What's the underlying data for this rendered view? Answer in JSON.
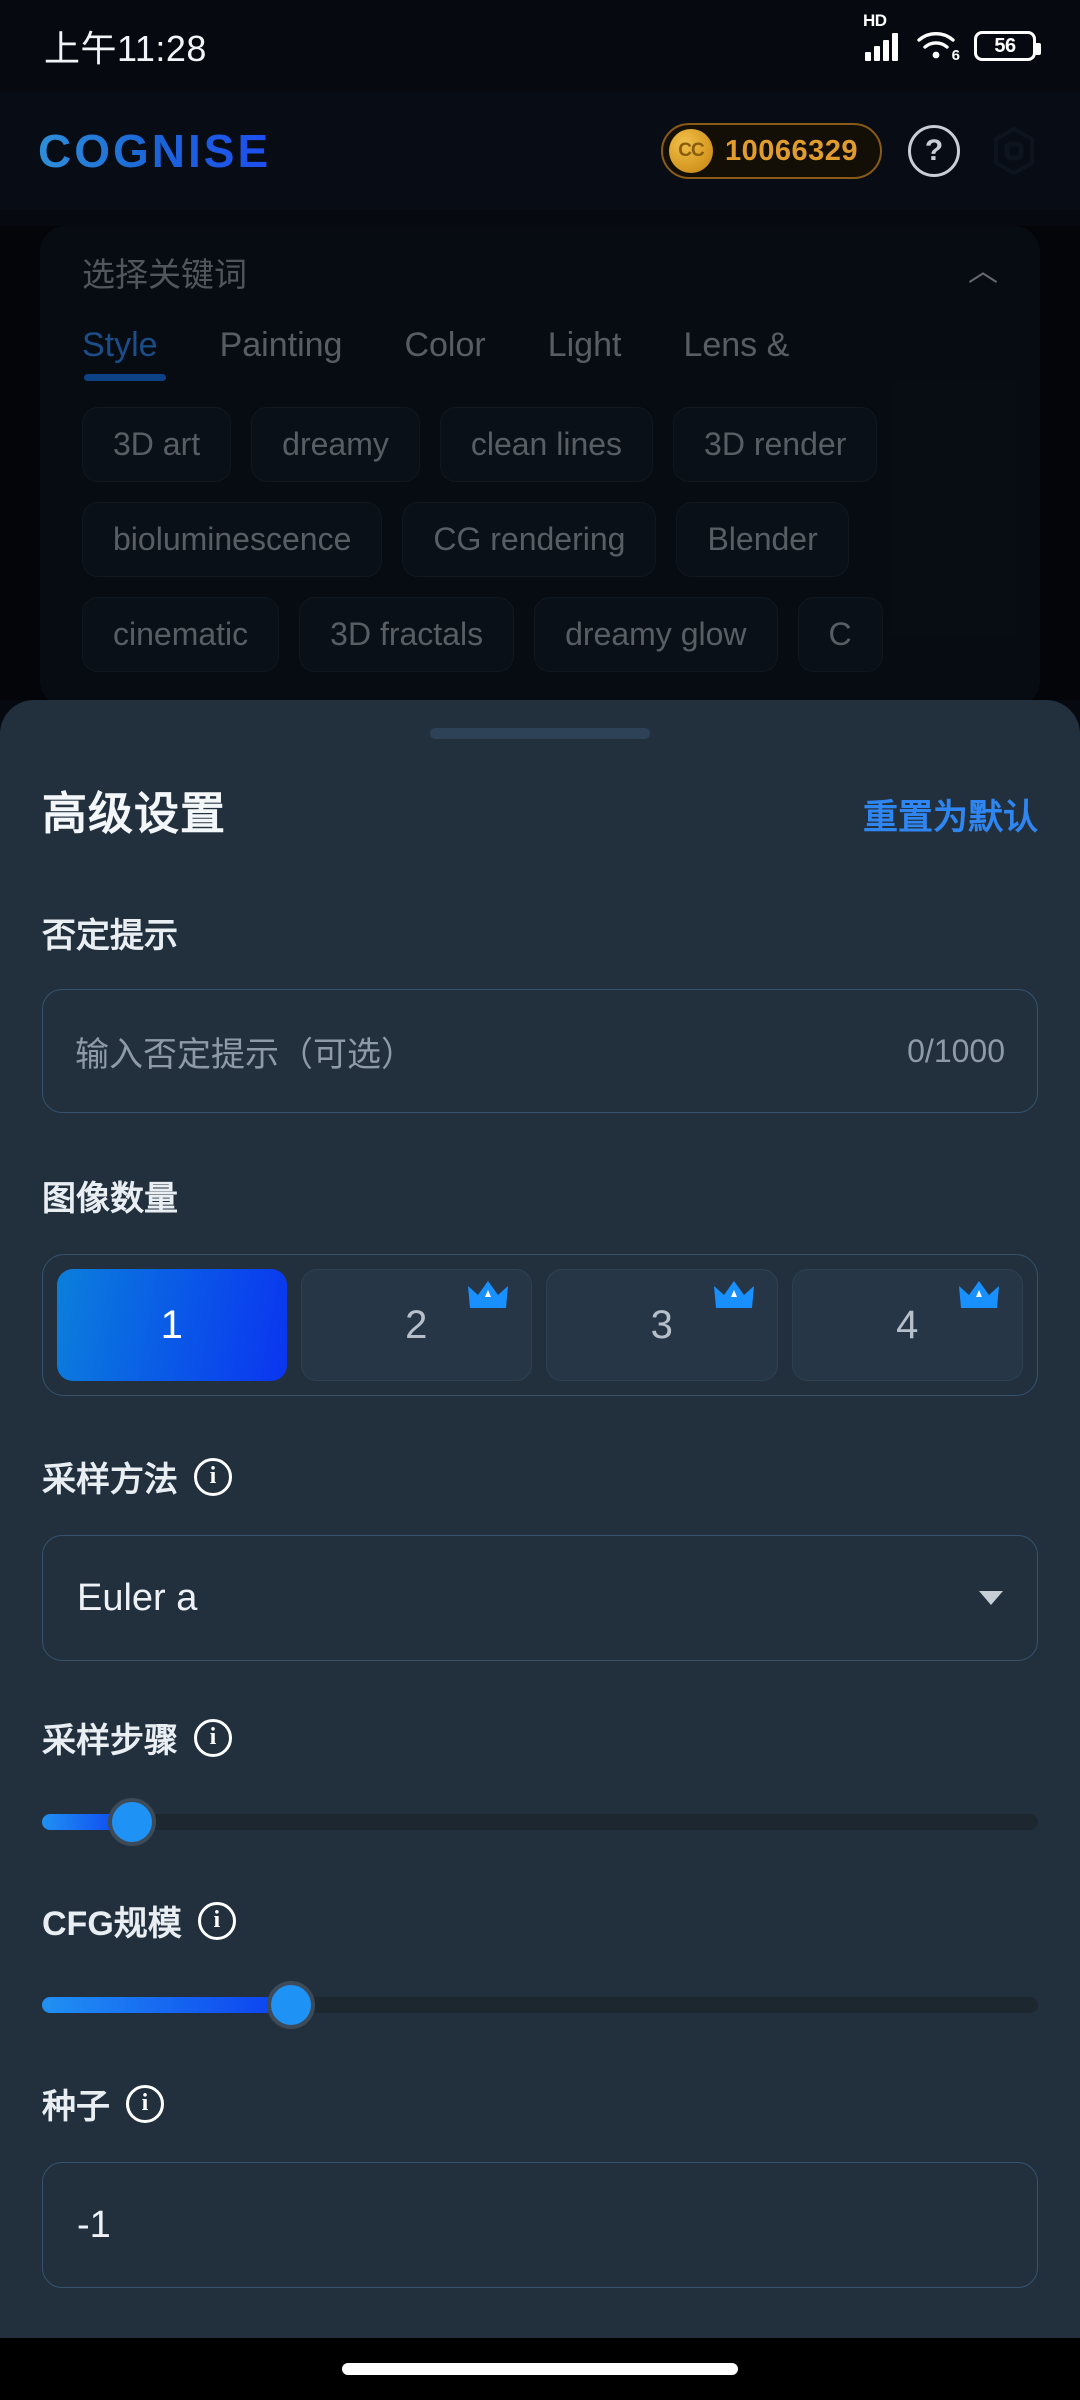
{
  "status_bar": {
    "time": "上午11:28",
    "network_tag": "HD",
    "wifi_generation": "6",
    "battery_level": "56"
  },
  "app_header": {
    "logo": "COGNISE",
    "coin_symbol": "CC",
    "coin_balance": "10066329",
    "help_glyph": "?",
    "icons": [
      "coin-badge",
      "help-icon",
      "settings-icon"
    ]
  },
  "keyword_panel": {
    "title": "选择关键词",
    "collapse_glyph": "︿",
    "tabs": [
      {
        "label": "Style",
        "active": true
      },
      {
        "label": "Painting",
        "active": false
      },
      {
        "label": "Color",
        "active": false
      },
      {
        "label": "Light",
        "active": false
      },
      {
        "label": "Lens &",
        "active": false
      }
    ],
    "chips": [
      "3D art",
      "dreamy",
      "clean lines",
      "3D render",
      "bioluminescence",
      "CG rendering",
      "Blender",
      "cinematic",
      "3D fractals",
      "dreamy glow",
      "C"
    ]
  },
  "sheet": {
    "title": "高级设置",
    "reset_label": "重置为默认",
    "negative_prompt": {
      "label": "否定提示",
      "placeholder": "输入否定提示（可选）",
      "counter": "0/1000",
      "value": ""
    },
    "image_count": {
      "label": "图像数量",
      "options": [
        {
          "value": "1",
          "premium": false,
          "selected": true
        },
        {
          "value": "2",
          "premium": true,
          "selected": false
        },
        {
          "value": "3",
          "premium": true,
          "selected": false
        },
        {
          "value": "4",
          "premium": true,
          "selected": false
        }
      ]
    },
    "sampling_method": {
      "label": "采样方法",
      "info_glyph": "i",
      "value": "Euler a"
    },
    "sampling_steps": {
      "label": "采样步骤",
      "info_glyph": "i",
      "percent": 9
    },
    "cfg_scale": {
      "label": "CFG规模",
      "info_glyph": "i",
      "percent": 25
    },
    "seed": {
      "label": "种子",
      "info_glyph": "i",
      "value": "-1"
    }
  },
  "colors": {
    "accent_blue": "#2f86f0",
    "sheet_bg": "#22303e",
    "coin_gold": "#e09c2c",
    "page_bg": "#060a10"
  }
}
